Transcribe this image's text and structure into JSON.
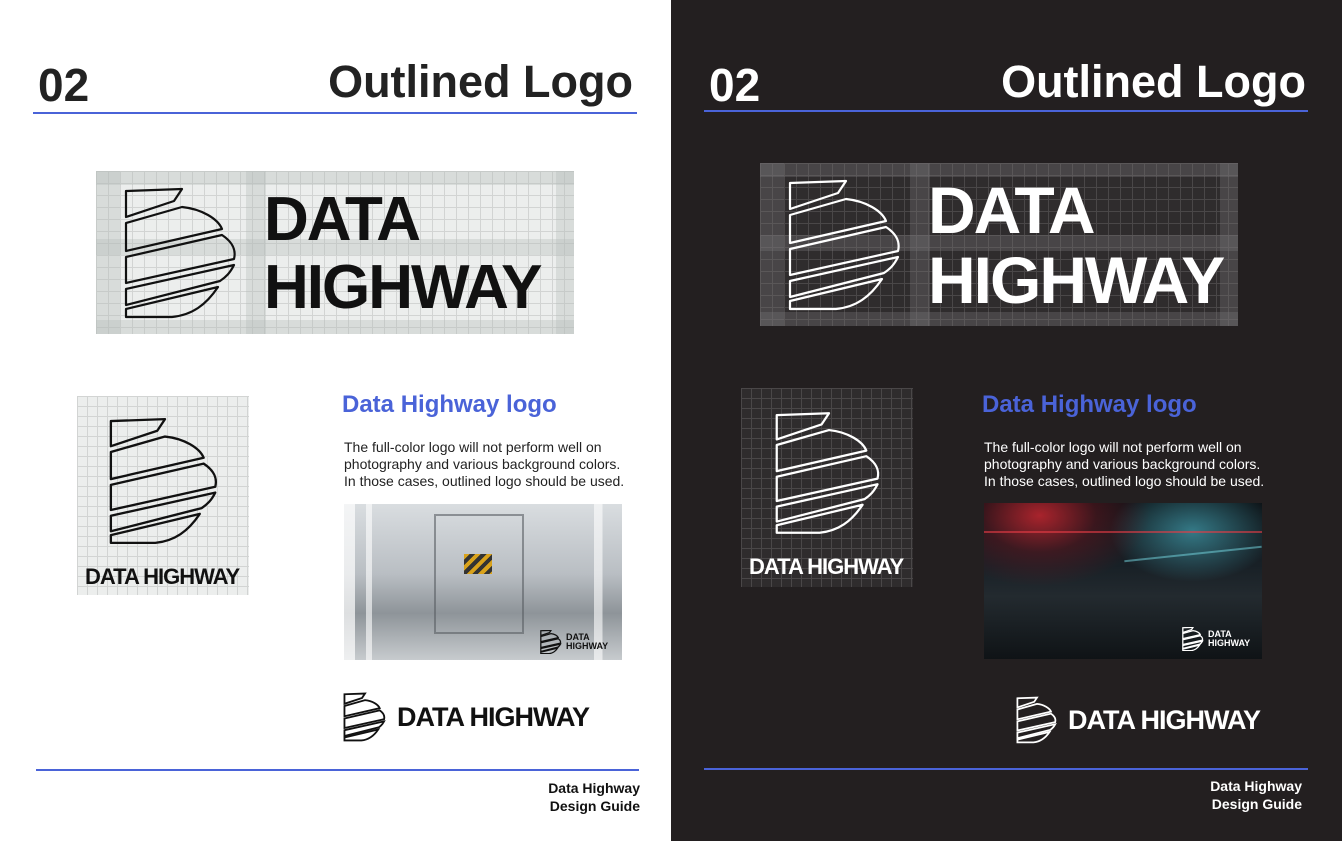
{
  "page": {
    "number": "02",
    "title": "Outlined Logo",
    "accent_color": "#4a63d8",
    "dark_background": "#231f20"
  },
  "logo": {
    "line1": "DATA",
    "line2": "HIGHWAY",
    "single_line": "DATA HIGHWAY",
    "mark_icon": "striped-b-mark-icon"
  },
  "section": {
    "heading": "Data Highway logo",
    "paragraph": "The full-color logo will not perform well on photography and various background colors. In those cases, outlined logo should be used."
  },
  "footer": {
    "line1": "Data Highway",
    "line2": "Design Guide"
  }
}
